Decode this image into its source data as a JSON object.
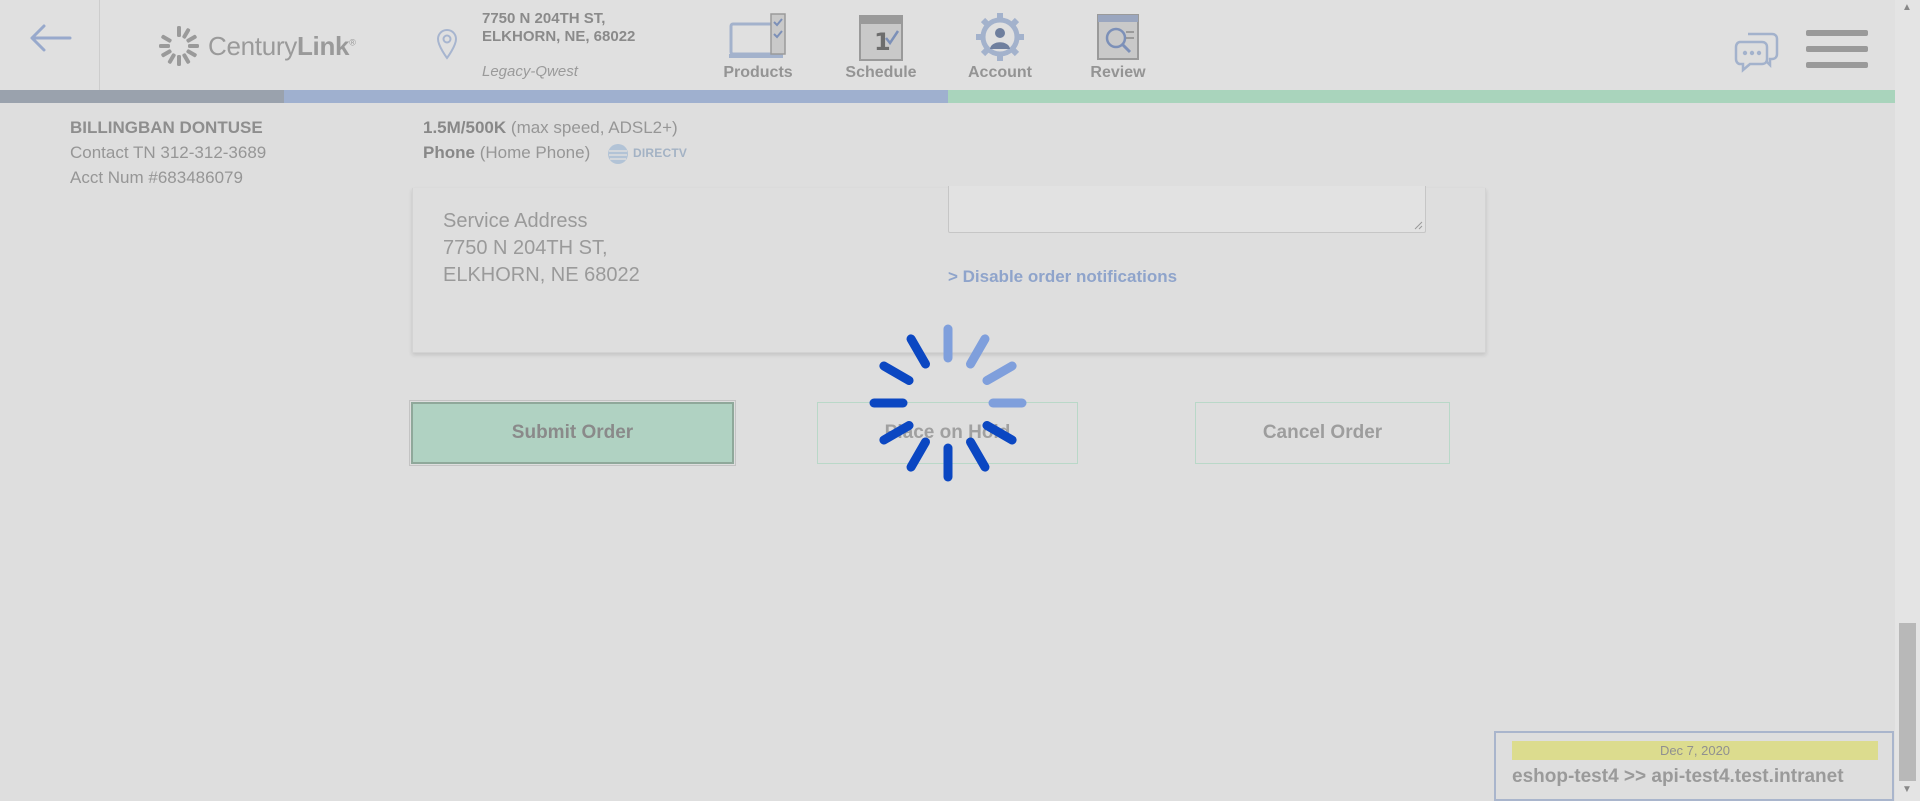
{
  "header": {
    "logo_text": "CenturyLink",
    "address_line1": "7750 N 204TH ST,",
    "address_line2": "ELKHORN, NE, 68022",
    "legacy": "Legacy-Qwest",
    "nav": [
      {
        "label": "Products",
        "icon": "tv-checklist-icon"
      },
      {
        "label": "Schedule",
        "icon": "calendar-icon"
      },
      {
        "label": "Account",
        "icon": "gear-user-icon"
      },
      {
        "label": "Review",
        "icon": "document-search-icon"
      }
    ],
    "progress_colors": [
      "#9aa2ad",
      "#9fb0cf",
      "#a9d4bc"
    ]
  },
  "customer": {
    "name": "BILLINGBAN DONTUSE",
    "contact": "Contact TN 312-312-3689",
    "acct": "Acct Num #683486079"
  },
  "service": {
    "speed": "1.5M/500K",
    "speed_detail": "(max speed, ADSL2+)",
    "phone": "Phone",
    "phone_detail": "(Home Phone)",
    "partner": "DIRECTV"
  },
  "card": {
    "service_address_label": "Service Address",
    "service_address_line1": "7750 N 204TH ST,",
    "service_address_line2": "ELKHORN, NE 68022",
    "disable_link": "> Disable order notifications"
  },
  "buttons": {
    "submit": "Submit Order",
    "hold": "Place on Hold",
    "cancel": "Cancel Order"
  },
  "env": {
    "date": "Dec 7, 2020",
    "host": "eshop-test4 >> api-test4.test.intranet"
  },
  "colors": {
    "spinner": "#0b47c2",
    "spinner_light": "#7f9fdc",
    "submit_bg": "#b0d2c2"
  }
}
